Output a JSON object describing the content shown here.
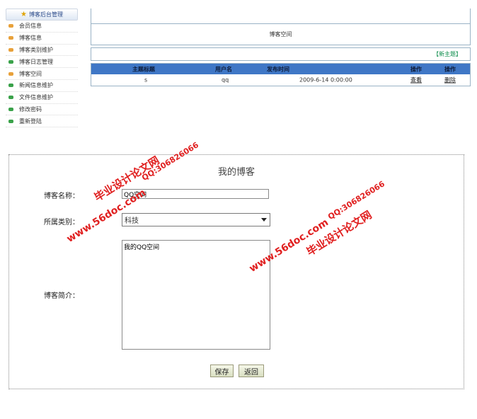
{
  "sidebar": {
    "header": "博客后台管理",
    "items": [
      {
        "label": "会员信息",
        "color": "#e8a13a"
      },
      {
        "label": "博客信息",
        "color": "#e8a13a"
      },
      {
        "label": "博客类别维护",
        "color": "#e8a13a"
      },
      {
        "label": "博客日志管理",
        "color": "#3aa24a"
      },
      {
        "label": "博客空间",
        "color": "#e8a13a"
      },
      {
        "label": "新闻信息维护",
        "color": "#3aa24a"
      },
      {
        "label": "文件信息维护",
        "color": "#3aa24a"
      },
      {
        "label": "修改密码",
        "color": "#3aa24a"
      },
      {
        "label": "重新登陆",
        "color": "#3aa24a"
      }
    ]
  },
  "top": {
    "title": "博客空间",
    "new_link": "【新主题】",
    "table": {
      "headers": [
        "主题标题",
        "用户名",
        "发布时间",
        "操作",
        "操作"
      ],
      "rows": [
        {
          "title": "s",
          "user": "qq",
          "time": "2009-6-14 0:00:00",
          "view": "查看",
          "delete": "删除"
        }
      ]
    }
  },
  "form": {
    "title": "我的博客",
    "name_label": "博客名称：",
    "name_value": "QQ空间",
    "category_label": "所属类别：",
    "category_value": "科技",
    "intro_label": "博客简介：",
    "intro_value": "我的QQ空间",
    "save_label": "保存",
    "back_label": "返回"
  },
  "watermark": {
    "site_cn": "毕业设计论文网",
    "url": "www.56doc.com",
    "qq": "QQ:306826066",
    "color": "#e02020"
  }
}
